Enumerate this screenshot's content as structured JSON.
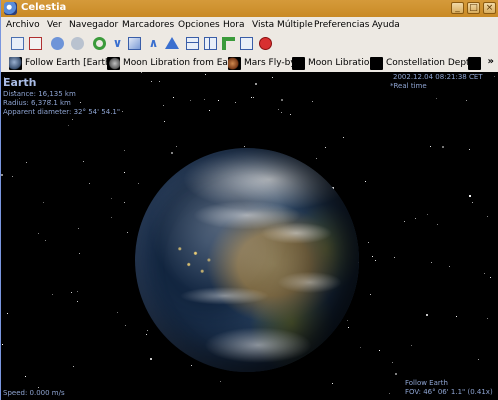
{
  "window": {
    "title": "Celestia"
  },
  "menu": [
    "Archivo",
    "Ver",
    "Navegador",
    "Marcadores",
    "Opciones",
    "Hora",
    "Vista Múltiple",
    "Preferencias",
    "Ayuda"
  ],
  "bookmarks": [
    {
      "label": "Follow Earth [Earth]",
      "thumb": "earth"
    },
    {
      "label": "Moon Libration from Earth",
      "thumb": "moon"
    },
    {
      "label": "Mars Fly-by",
      "thumb": "mars"
    },
    {
      "label": "Moon Libration",
      "thumb": "dark"
    },
    {
      "label": "Constellation Depth",
      "thumb": "dark"
    }
  ],
  "overflow_label": "»",
  "hud": {
    "object_name": "Earth",
    "distance": "Distance: 16,135 km",
    "radius": "Radius: 6,378.1 km",
    "apparent_diameter": "Apparent diameter: 32° 54' 54.1\"",
    "datetime": "2002.12.04 08:21:38 CET",
    "time_mode": "Real time",
    "speed": "Speed: 0.000 m/s",
    "follow": "Follow Earth",
    "fov": "FOV: 46° 06' 1.1\" (0.41x)"
  },
  "colors": {
    "titlebar": "#c98a25",
    "chrome": "#ede9e3",
    "hud_text": "#8ea4d2"
  }
}
